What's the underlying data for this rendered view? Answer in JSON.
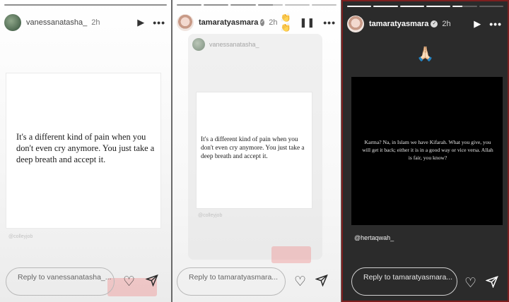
{
  "stories": [
    {
      "username": "vanessanatasha_",
      "time": "2h",
      "progress": [
        1
      ],
      "icons": [
        "play-icon",
        "more-icon"
      ],
      "quote": "It's a different kind of pain when you don't even cry anymore. You just take a deep breath and accept it.",
      "credit": "@colleyjob",
      "reply_placeholder": "Reply to vanessanatasha_..."
    },
    {
      "username": "tamaratyasmara",
      "verified": true,
      "time": "2h",
      "progress": [
        1,
        1,
        1,
        0.6,
        0,
        0
      ],
      "icons": [
        "pause-icon",
        "more-icon"
      ],
      "reshared_username": "vanessanatasha_",
      "quote": "It's a different kind of pain when you don't even cry anymore. You just take a deep breath and accept it.",
      "credit": "@colleyjob",
      "reply_placeholder": "Reply to tamaratyasmara..."
    },
    {
      "username": "tamaratyasmara",
      "verified": true,
      "time": "2h",
      "progress": [
        1,
        1,
        1,
        1,
        0.4,
        0
      ],
      "icons": [
        "play-icon",
        "more-icon"
      ],
      "emoji": "🙏🏻",
      "quote": "Karma? Na, in Islam we have Kifarah. What you give, you will get it back; either it is in a good way or vice versa. Allah is fair, you know?",
      "mention": "@hertaqwah_",
      "reply_placeholder": "Reply to tamaratyasmara..."
    }
  ],
  "colors": {
    "light_bg": "#ffffff",
    "dark_bg": "#2b2b2b",
    "card_dark": "#000000",
    "selected_border": "#7d1f1f"
  }
}
